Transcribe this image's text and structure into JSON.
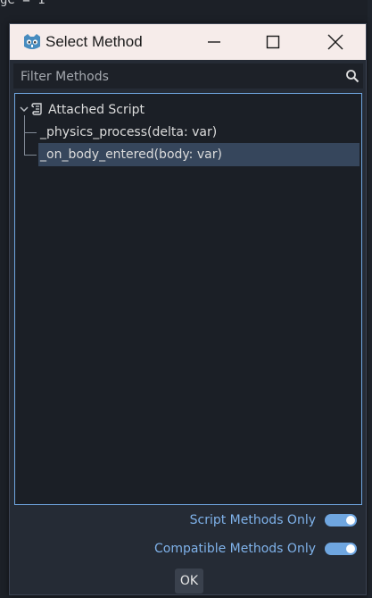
{
  "background": {
    "top_snippet": "ge = 1"
  },
  "dialog": {
    "title": "Select Method",
    "filter_placeholder": "Filter Methods",
    "tree": {
      "root_label": "Attached Script",
      "items": [
        {
          "label": "_physics_process(delta: var)"
        },
        {
          "label": "_on_body_entered(body: var)"
        }
      ]
    },
    "toggles": {
      "script_methods_only": {
        "label": "Script Methods Only",
        "on": true
      },
      "compatible_methods_only": {
        "label": "Compatible Methods Only",
        "on": true
      }
    },
    "ok_label": "OK"
  },
  "colors": {
    "accent": "#6fa6e0",
    "selection": "#36465c",
    "titlebar": "#f6ecea",
    "panel": "#252b35"
  },
  "icons": {
    "app": "godot-icon",
    "minimize": "minimize-icon",
    "maximize": "maximize-icon",
    "close": "close-icon",
    "search": "search-icon",
    "tree_arrow": "chevron-down-icon",
    "script": "script-icon"
  }
}
